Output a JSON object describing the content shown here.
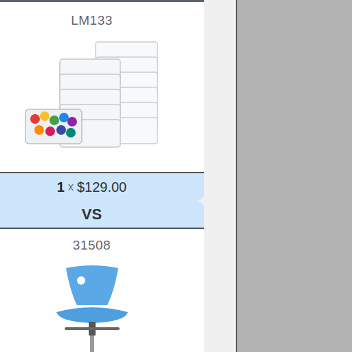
{
  "products": [
    {
      "code": "LM133",
      "quantity": "1",
      "times": "x",
      "price": "$129.00"
    },
    {
      "code": "31508"
    }
  ],
  "separator": "VS"
}
